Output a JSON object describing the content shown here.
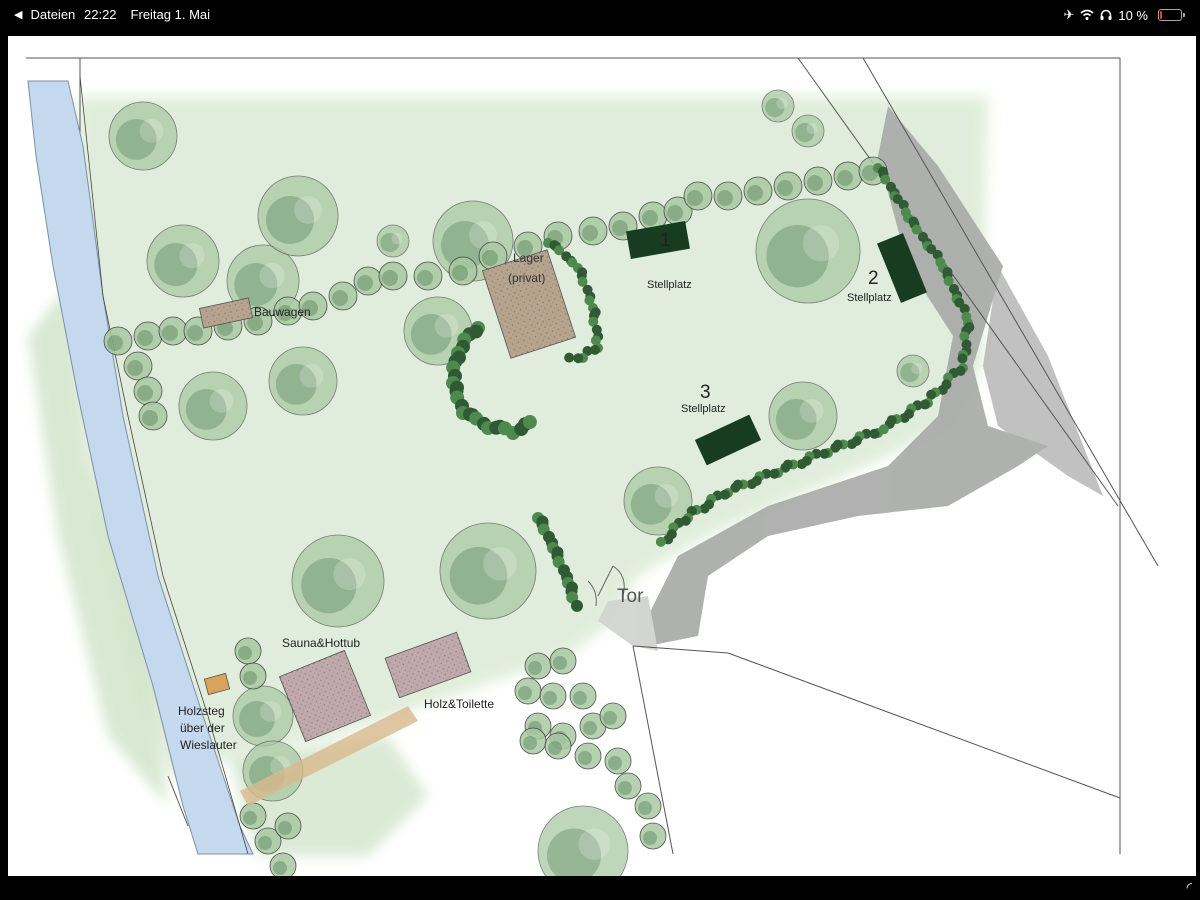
{
  "status_bar": {
    "back_label": "Dateien",
    "time": "22:22",
    "date": "Freitag 1. Mai",
    "battery_text": "10 %",
    "battery_level": 0.1,
    "icons": [
      "back-arrow-icon",
      "airplane-icon",
      "wifi-icon",
      "headphones-icon",
      "battery-icon"
    ]
  },
  "map": {
    "river_label_1": "Holzsteg",
    "river_label_2": "über der",
    "river_label_3": "Wieslauter",
    "bauwagen": "Bauwagen",
    "lager_1": "Lager",
    "lager_2": "(privat)",
    "stellplatz_1_num": "1",
    "stellplatz_2_num": "2",
    "stellplatz_3_num": "3",
    "stellplatz": "Stellplatz",
    "tor": "Tor",
    "sauna": "Sauna&Hottub",
    "holz": "Holz&Toilette"
  },
  "colors": {
    "lawn": "#dcebd6",
    "tree_dark": "#4d7a52",
    "tree_light": "#a9c9a3",
    "road": "#a7a9a7",
    "river": "#c5d9ee",
    "building": "#b6a48f",
    "stellplatz_rect": "#173c1f"
  }
}
